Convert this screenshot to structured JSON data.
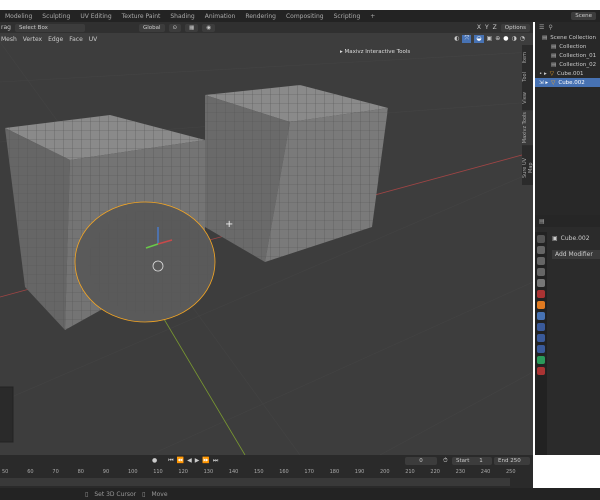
{
  "workspaces": [
    "Modeling",
    "Sculpting",
    "UV Editing",
    "Texture Paint",
    "Shading",
    "Animation",
    "Rendering",
    "Compositing",
    "Scripting",
    "+"
  ],
  "scene": {
    "label": "Scene"
  },
  "tool_header": {
    "drag_label": "rag",
    "select_mode": "Select Box",
    "orientation": "Global"
  },
  "viewport_menu": [
    "Mesh",
    "Vertex",
    "Edge",
    "Face",
    "UV"
  ],
  "axes": [
    "X",
    "Y",
    "Z"
  ],
  "options_label": "Options",
  "addon_panel": "Maxivz Interactive Tools",
  "n_tabs": [
    "Item",
    "Tool",
    "View",
    "Maxivz Tools",
    "Sure UV Map"
  ],
  "outliner": {
    "items": [
      {
        "label": "Scene Collection",
        "icon": "collection-icon"
      },
      {
        "label": "Collection",
        "icon": "collection-icon"
      },
      {
        "label": "Collection_01",
        "icon": "collection-icon"
      },
      {
        "label": "Collection_02",
        "icon": "collection-icon"
      },
      {
        "label": "Cube.001",
        "icon": "mesh-icon"
      },
      {
        "label": "Cube.002",
        "icon": "mesh-icon",
        "selected": true
      }
    ]
  },
  "properties": {
    "object_name": "Cube.002",
    "add_modifier": "Add Modifier"
  },
  "timeline": {
    "current_frame": "0",
    "start_label": "Start",
    "start": "1",
    "end_label": "End",
    "end": "250",
    "ticks": [
      "50",
      "60",
      "70",
      "80",
      "90",
      "100",
      "110",
      "120",
      "130",
      "140",
      "150",
      "160",
      "170",
      "180",
      "190",
      "200",
      "210",
      "220",
      "230",
      "240",
      "250"
    ]
  },
  "status": {
    "set_cursor": "Set 3D Cursor",
    "move": "Move"
  },
  "colors": {
    "accent": "#4772b3",
    "selection": "#f5a623",
    "x_axis": "#a04545",
    "y_axis": "#7a9a30"
  }
}
